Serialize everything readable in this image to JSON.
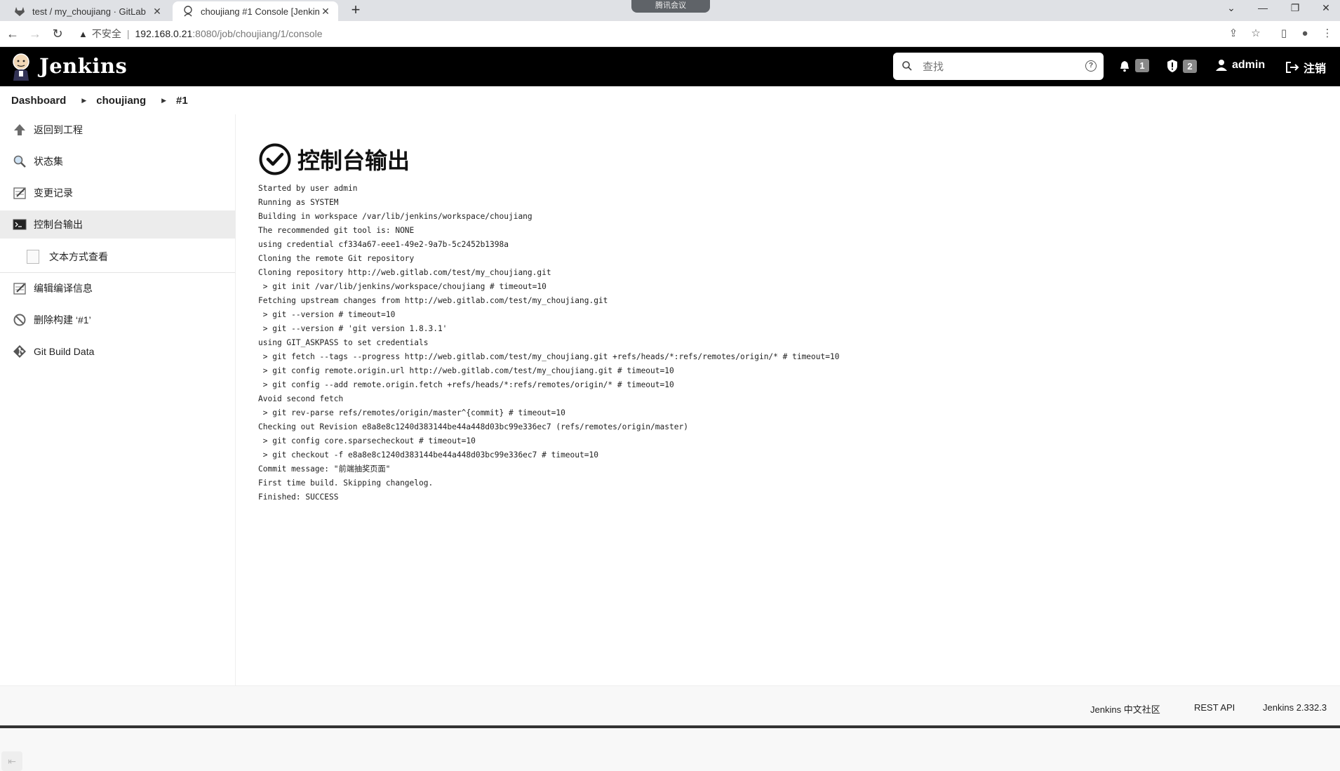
{
  "browser": {
    "tabs": [
      {
        "title": "test / my_choujiang · GitLab",
        "icon": "gitlab-icon",
        "close": "✕"
      },
      {
        "title": "choujiang #1 Console [Jenkins]",
        "icon": "jenkins-icon",
        "close": "✕"
      }
    ],
    "new_tab": "+",
    "meeting_pill": "腾讯会议",
    "insecure_label": "不安全",
    "url_host": "192.168.0.21",
    "url_path": ":8080/job/choujiang/1/console"
  },
  "header": {
    "brand": "Jenkins",
    "search_placeholder": "查找",
    "notifications_count": "1",
    "security_count": "2",
    "user": "admin",
    "logout": "注销"
  },
  "breadcrumb": [
    "Dashboard",
    "choujiang",
    "#1"
  ],
  "sidebar": {
    "items": [
      {
        "label": "返回到工程",
        "icon": "up-arrow-icon"
      },
      {
        "label": "状态集",
        "icon": "magnifier-icon"
      },
      {
        "label": "变更记录",
        "icon": "notepad-icon"
      },
      {
        "label": "控制台输出",
        "icon": "terminal-icon"
      },
      {
        "label": "文本方式查看",
        "icon": "document-icon"
      },
      {
        "label": "编辑编译信息",
        "icon": "notepad-icon"
      },
      {
        "label": "删除构建 ‘#1’",
        "icon": "no-entry-icon"
      },
      {
        "label": "Git Build Data",
        "icon": "git-icon"
      }
    ],
    "active_index": 3
  },
  "main": {
    "title": "控制台输出",
    "status_icon": "check-circle-icon",
    "console_lines": [
      "Started by user admin",
      "Running as SYSTEM",
      "Building in workspace /var/lib/jenkins/workspace/choujiang",
      "The recommended git tool is: NONE",
      "using credential cf334a67-eee1-49e2-9a7b-5c2452b1398a",
      "Cloning the remote Git repository",
      "Cloning repository http://web.gitlab.com/test/my_choujiang.git",
      " > git init /var/lib/jenkins/workspace/choujiang # timeout=10",
      "Fetching upstream changes from http://web.gitlab.com/test/my_choujiang.git",
      " > git --version # timeout=10",
      " > git --version # 'git version 1.8.3.1'",
      "using GIT_ASKPASS to set credentials",
      " > git fetch --tags --progress http://web.gitlab.com/test/my_choujiang.git +refs/heads/*:refs/remotes/origin/* # timeout=10",
      " > git config remote.origin.url http://web.gitlab.com/test/my_choujiang.git # timeout=10",
      " > git config --add remote.origin.fetch +refs/heads/*:refs/remotes/origin/* # timeout=10",
      "Avoid second fetch",
      " > git rev-parse refs/remotes/origin/master^{commit} # timeout=10",
      "Checking out Revision e8a8e8c1240d383144be44a448d03bc99e336ec7 (refs/remotes/origin/master)",
      " > git config core.sparsecheckout # timeout=10",
      " > git checkout -f e8a8e8c1240d383144be44a448d03bc99e336ec7 # timeout=10",
      "Commit message: \"前端抽奖页面\"",
      "First time build. Skipping changelog.",
      "Finished: SUCCESS"
    ]
  },
  "footer": {
    "community": "Jenkins 中文社区",
    "rest_api": "REST API",
    "version": "Jenkins 2.332.3"
  }
}
